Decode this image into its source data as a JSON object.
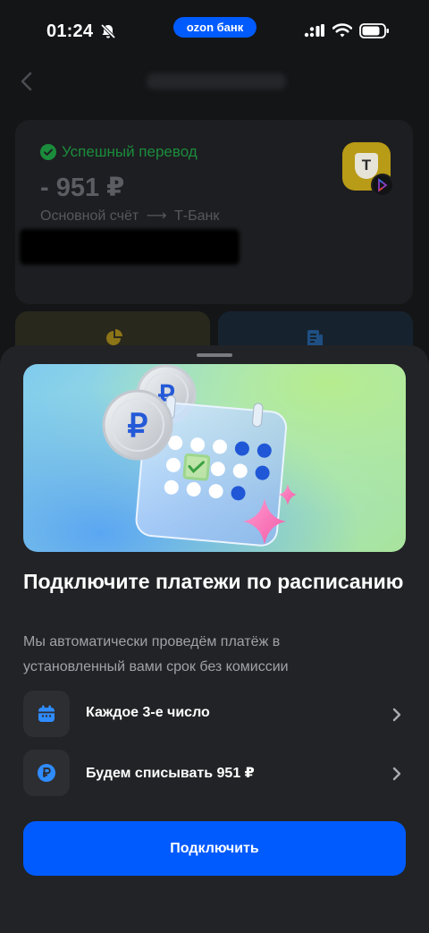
{
  "status_bar": {
    "time": "01:24",
    "bank_label": "ozon банк",
    "icons": [
      "bell-off-icon",
      "signal-icon",
      "wifi-icon",
      "battery-icon"
    ]
  },
  "background_page": {
    "transfer_status": "Успешный перевод",
    "amount": "- 951 ₽",
    "route_from": "Основной счёт",
    "route_arrow": "⟶",
    "route_to": "Т-Банк",
    "bank_logo_letter": "Т",
    "colors": {
      "success": "#1b8c3c"
    }
  },
  "sheet": {
    "title": "Подключите платежи по расписанию",
    "description": "Мы автоматически проведём платёж в установленный вами срок без комиссии",
    "options": [
      {
        "label": "Каждое 3-е число",
        "icon": "calendar-icon"
      },
      {
        "label": "Будем списывать 951 ₽",
        "icon": "ruble-icon"
      }
    ],
    "connect_label": "Подключить",
    "coin_symbol": "₽",
    "colors": {
      "accent": "#005bff",
      "icon_blue": "#2f8cff"
    }
  }
}
